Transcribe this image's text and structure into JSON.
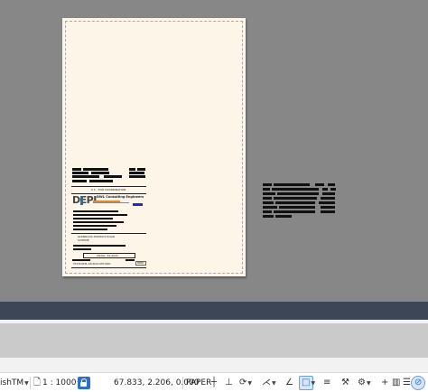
{
  "drawing": {
    "title_block": {
      "stage_label": "0 1 - FOR COORDINATION",
      "company_line": "DWL Consulting Engineers",
      "logo_text": "DEPL",
      "project_line": "GLENROCK DISTRICT ROAD",
      "project_sub": "SCHEME",
      "contract_no": "CN-No. 34-2021",
      "drawing_no": "07476-DEPL-DD-SK01-DET-0001",
      "print_label": "PRINT"
    }
  },
  "status_bar": {
    "layout_name": "ishTM",
    "scale": "1 : 1000",
    "coordinates": "67.833, 2.206, 0.000",
    "space": "PAPER",
    "icons": [
      "paper-space-icon",
      "lock-icon",
      "grid-snap-icon",
      "ortho-icon",
      "polar-icon",
      "isodraft-icon",
      "osnap-icon",
      "selection-box-icon",
      "lineweight-icon",
      "annotation-scale-icon",
      "workspace-gear-icon",
      "customize-icon",
      "clean-screen-icon"
    ]
  },
  "colors": {
    "paper": "#fdf6e8",
    "background": "#878787",
    "band": "#3c4656",
    "accent_blue": "#2d6fc2"
  }
}
